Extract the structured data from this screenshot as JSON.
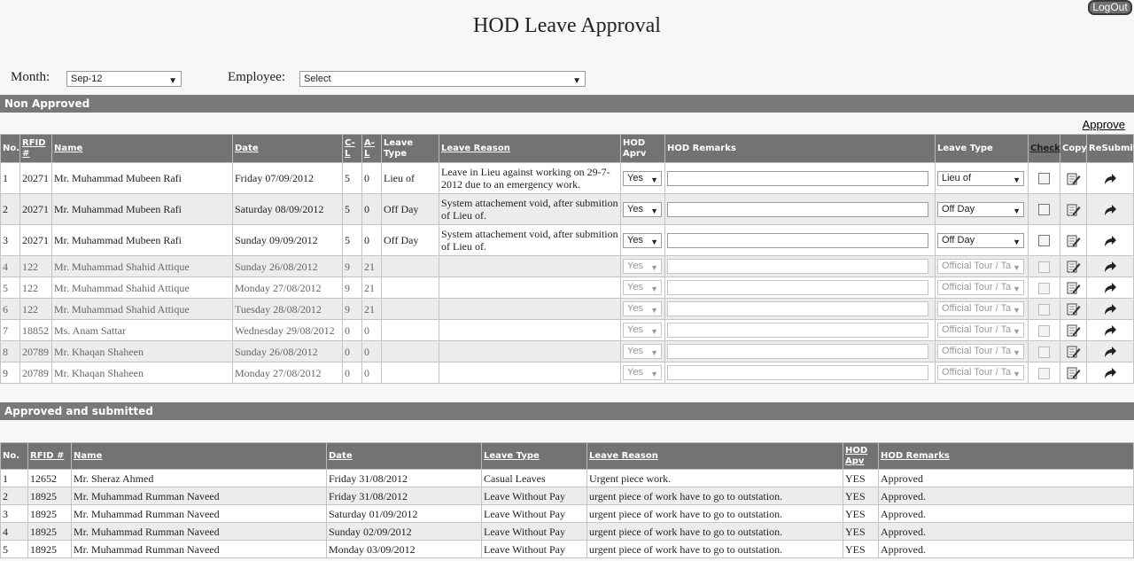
{
  "header": {
    "title": "HOD Leave Approval",
    "logout_label": "LogOut"
  },
  "filters": {
    "month_label": "Month:",
    "month_value": "Sep-12",
    "employee_label": "Employee:",
    "employee_value": "Select"
  },
  "non_approved": {
    "section_title": "Non Approved",
    "approve_label": "Approve",
    "headers": {
      "no": "No.",
      "rfid": "RFID #",
      "name": "Name",
      "date": "Date",
      "cl": "C-L",
      "al": "A-L",
      "leave_type": "Leave Type",
      "leave_reason": "Leave Reason",
      "hod_aprv": "HOD Aprv",
      "hod_remarks": "HOD Remarks",
      "leave_type2": "Leave Type",
      "check": "Check",
      "copy": "Copy",
      "resubmit": "ReSubmit"
    },
    "rows": [
      {
        "no": "1",
        "rfid": "20271",
        "name": "Mr. Muhammad Mubeen Rafi",
        "date": "Friday 07/09/2012",
        "cl": "5",
        "al": "0",
        "leave_type": "Lieu of",
        "reason": "Leave in Lieu against working on 29-7-2012 due to an emergency work.",
        "aprv": "Yes",
        "type_select": "Lieu of"
      },
      {
        "no": "2",
        "rfid": "20271",
        "name": "Mr. Muhammad Mubeen Rafi",
        "date": "Saturday 08/09/2012",
        "cl": "5",
        "al": "0",
        "leave_type": "Off Day",
        "reason": "System attachement void, after submition of Lieu of.",
        "aprv": "Yes",
        "type_select": "Off Day"
      },
      {
        "no": "3",
        "rfid": "20271",
        "name": "Mr. Muhammad Mubeen Rafi",
        "date": "Sunday 09/09/2012",
        "cl": "5",
        "al": "0",
        "leave_type": "Off Day",
        "reason": "System attachement void, after submition of Lieu of.",
        "aprv": "Yes",
        "type_select": "Off Day"
      },
      {
        "no": "4",
        "rfid": "122",
        "name": "Mr. Muhammad Shahid Attique",
        "date": "Sunday 26/08/2012",
        "cl": "9",
        "al": "21",
        "leave_type": "",
        "reason": "",
        "aprv": "Yes",
        "type_select": "Official Tour / Ta"
      },
      {
        "no": "5",
        "rfid": "122",
        "name": "Mr. Muhammad Shahid Attique",
        "date": "Monday 27/08/2012",
        "cl": "9",
        "al": "21",
        "leave_type": "",
        "reason": "",
        "aprv": "Yes",
        "type_select": "Official Tour / Ta"
      },
      {
        "no": "6",
        "rfid": "122",
        "name": "Mr. Muhammad Shahid Attique",
        "date": "Tuesday 28/08/2012",
        "cl": "9",
        "al": "21",
        "leave_type": "",
        "reason": "",
        "aprv": "Yes",
        "type_select": "Official Tour / Ta"
      },
      {
        "no": "7",
        "rfid": "18852",
        "name": "Ms. Anam Sattar",
        "date": "Wednesday 29/08/2012",
        "cl": "0",
        "al": "0",
        "leave_type": "",
        "reason": "",
        "aprv": "Yes",
        "type_select": "Official Tour / Ta"
      },
      {
        "no": "8",
        "rfid": "20789",
        "name": "Mr. Khaqan Shaheen",
        "date": "Sunday 26/08/2012",
        "cl": "0",
        "al": "0",
        "leave_type": "",
        "reason": "",
        "aprv": "Yes",
        "type_select": "Official Tour / Ta"
      },
      {
        "no": "9",
        "rfid": "20789",
        "name": "Mr. Khaqan Shaheen",
        "date": "Monday 27/08/2012",
        "cl": "0",
        "al": "0",
        "leave_type": "",
        "reason": "",
        "aprv": "Yes",
        "type_select": "Official Tour / Ta"
      }
    ]
  },
  "approved": {
    "section_title": "Approved and submitted",
    "headers": {
      "no": "No.",
      "rfid": "RFID #",
      "name": "Name",
      "date": "Date",
      "leave_type": "Leave Type",
      "leave_reason": "Leave Reason",
      "hod_apv": "HOD Apv",
      "hod_remarks": "HOD Remarks"
    },
    "rows": [
      {
        "no": "1",
        "rfid": "12652",
        "name": "Mr. Sheraz Ahmed",
        "date": "Friday 31/08/2012",
        "leave_type": "Casual Leaves",
        "reason": "Urgent piece work.",
        "apv": "YES",
        "remarks": "Approved"
      },
      {
        "no": "2",
        "rfid": "18925",
        "name": "Mr. Muhammad Rumman Naveed",
        "date": "Friday 31/08/2012",
        "leave_type": "Leave Without Pay",
        "reason": "urgent piece of work have to go to outstation.",
        "apv": "YES",
        "remarks": "Approved."
      },
      {
        "no": "3",
        "rfid": "18925",
        "name": "Mr. Muhammad Rumman Naveed",
        "date": "Saturday 01/09/2012",
        "leave_type": "Leave Without Pay",
        "reason": "urgent piece of work have to go to outstation.",
        "apv": "YES",
        "remarks": "Approved."
      },
      {
        "no": "4",
        "rfid": "18925",
        "name": "Mr. Muhammad Rumman Naveed",
        "date": "Sunday 02/09/2012",
        "leave_type": "Leave Without Pay",
        "reason": "urgent piece of work have to go to outstation.",
        "apv": "YES",
        "remarks": "Approved."
      },
      {
        "no": "5",
        "rfid": "18925",
        "name": "Mr. Muhammad Rumman Naveed",
        "date": "Monday 03/09/2012",
        "leave_type": "Leave Without Pay",
        "reason": "urgent piece of work have to go to outstation.",
        "apv": "YES",
        "remarks": "Approved."
      }
    ]
  },
  "icons": {
    "copy": "edit-pencil-icon",
    "resubmit": "resubmit-arrow-icon",
    "dropdown": "chevron-down-icon"
  }
}
